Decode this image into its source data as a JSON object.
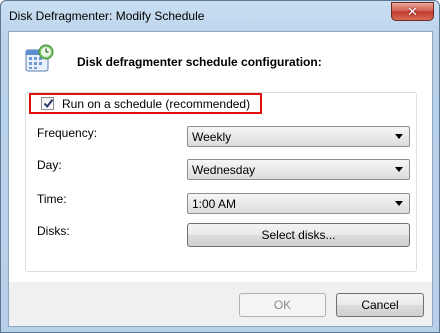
{
  "window": {
    "title": "Disk Defragmenter: Modify Schedule",
    "close_glyph": "✕",
    "close_color": "#c9412f"
  },
  "header": {
    "icon": "calendar-clock-icon",
    "title": "Disk defragmenter schedule configuration:"
  },
  "schedule": {
    "label": "Run on a schedule (recommended)",
    "checked": true,
    "highlight_color": "#e01010"
  },
  "fields": {
    "frequency": {
      "label": "Frequency:",
      "value": "Weekly"
    },
    "day": {
      "label": "Day:",
      "value": "Wednesday"
    },
    "time": {
      "label": "Time:",
      "value": "1:00 AM"
    },
    "disks": {
      "label": "Disks:",
      "button_label": "Select disks..."
    }
  },
  "footer": {
    "ok_label": "OK",
    "ok_enabled": false,
    "cancel_label": "Cancel"
  }
}
